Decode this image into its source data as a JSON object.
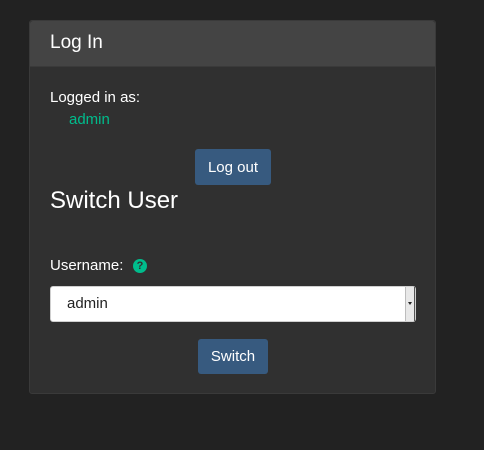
{
  "panel": {
    "title": "Log In"
  },
  "session": {
    "logged_in_label": "Logged in as:",
    "username": "admin",
    "logout_label": "Log out"
  },
  "switch_user": {
    "heading": "Switch User",
    "username_label": "Username:",
    "help_icon_glyph": "?",
    "selected_user": "admin",
    "submit_label": "Switch"
  },
  "colors": {
    "background": "#222222",
    "panel": "#303030",
    "panel_header": "#444444",
    "accent_green": "#00bc8c",
    "button_blue": "#375a7f"
  },
  "icons": {
    "help": "question-circle-icon",
    "dropdown": "chevron-down-icon"
  }
}
